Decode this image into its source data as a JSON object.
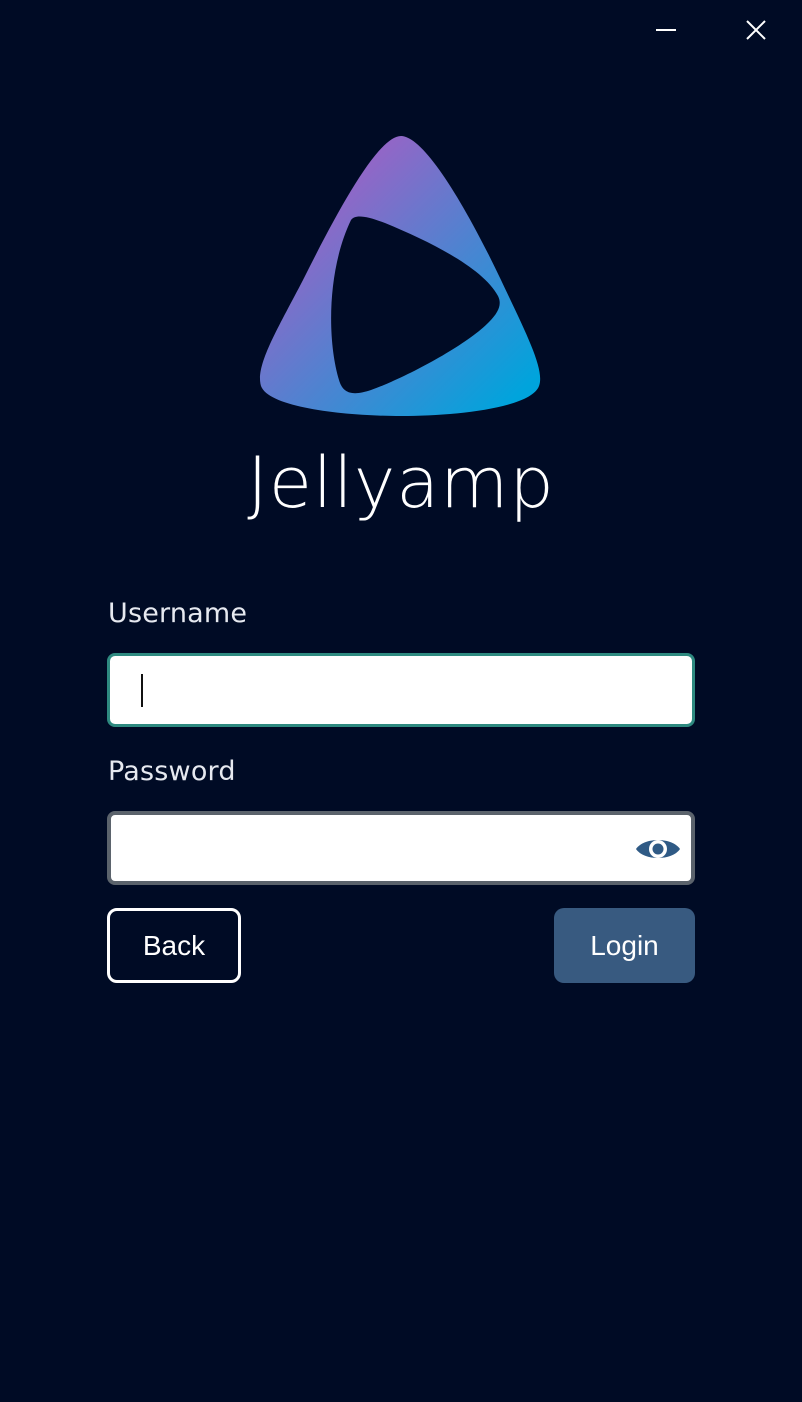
{
  "window": {
    "minimize_icon": "minimize-icon",
    "close_icon": "close-icon"
  },
  "brand": {
    "app_name": "Jellyamp",
    "logo_icon": "play-triangle-logo",
    "gradient_colors": [
      "#aa5cc3",
      "#00a4dc"
    ]
  },
  "form": {
    "username_label": "Username",
    "username_value": "",
    "password_label": "Password",
    "password_value": "",
    "show_password_icon": "eye-icon"
  },
  "actions": {
    "back_label": "Back",
    "login_label": "Login"
  },
  "colors": {
    "background": "#000b25",
    "focus_border": "#2e8a80",
    "login_button": "#385a80",
    "eye_icon": "#2f5a85"
  }
}
